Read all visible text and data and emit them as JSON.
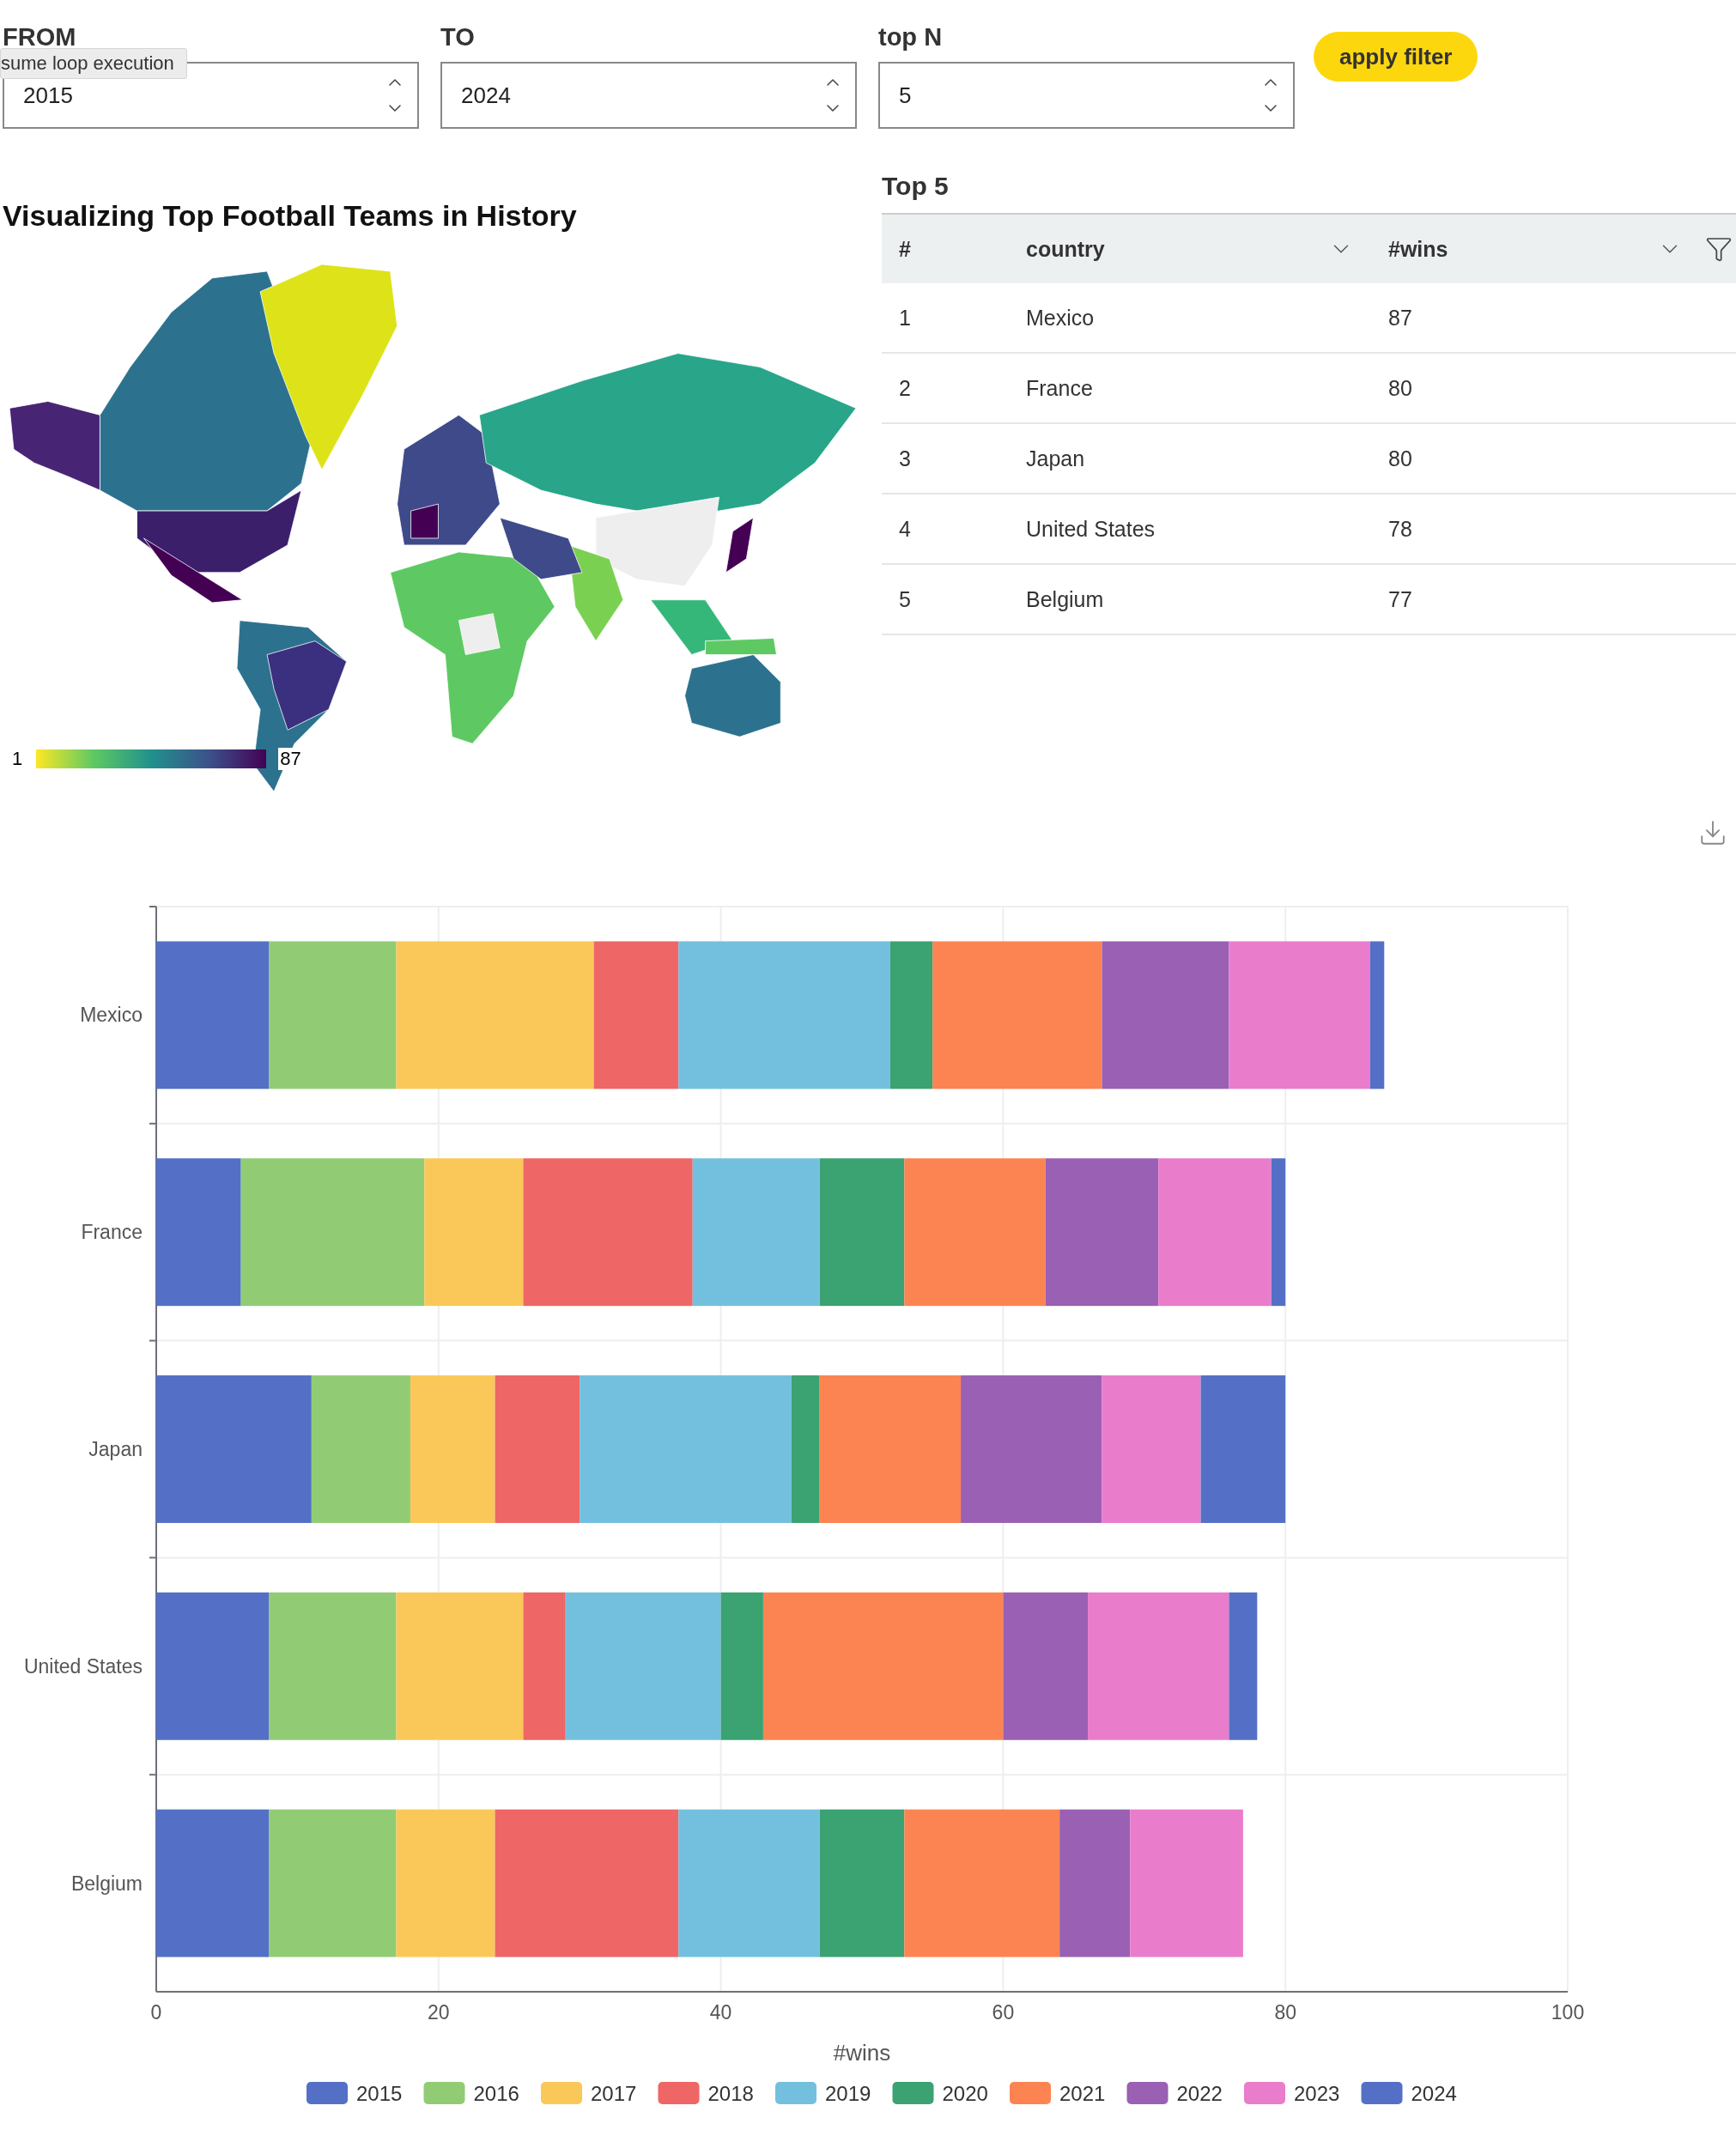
{
  "filters": [
    {
      "label": "FROM",
      "value": "2015"
    },
    {
      "label": "TO",
      "value": "2024"
    },
    {
      "label": "top N",
      "value": "5"
    }
  ],
  "tooltip": "sume loop execution",
  "apply_button": "apply filter",
  "map": {
    "title": "Visualizing Top Football Teams in History",
    "scale_min": "1",
    "scale_max": "87"
  },
  "table": {
    "title": "Top 5",
    "columns": [
      "#",
      "country",
      "#wins"
    ],
    "rows": [
      [
        "1",
        "Mexico",
        "87"
      ],
      [
        "2",
        "France",
        "80"
      ],
      [
        "3",
        "Japan",
        "80"
      ],
      [
        "4",
        "United States",
        "78"
      ],
      [
        "5",
        "Belgium",
        "77"
      ]
    ]
  },
  "chart": {
    "chart_data": {
      "type": "bar",
      "orientation": "horizontal",
      "stacked": true,
      "grid": true,
      "legend": true,
      "xlabel": "#wins",
      "xlim": [
        0,
        100
      ],
      "xticks": [
        {
          "value": 0,
          "label": "0"
        },
        {
          "value": 20,
          "label": "20"
        },
        {
          "value": 40,
          "label": "40"
        },
        {
          "value": 60,
          "label": "60"
        },
        {
          "value": 80,
          "label": "80"
        },
        {
          "value": 100,
          "label": "100"
        }
      ],
      "categories": [
        "Mexico",
        "France",
        "Japan",
        "United States",
        "Belgium"
      ],
      "series": [
        {
          "name": "2015",
          "color": "#5470c6",
          "values": [
            8,
            6,
            11,
            8,
            8
          ]
        },
        {
          "name": "2016",
          "color": "#91cc75",
          "values": [
            9,
            13,
            7,
            9,
            9
          ]
        },
        {
          "name": "2017",
          "color": "#fac858",
          "values": [
            14,
            7,
            6,
            9,
            7
          ]
        },
        {
          "name": "2018",
          "color": "#ee6666",
          "values": [
            6,
            12,
            6,
            3,
            13
          ]
        },
        {
          "name": "2019",
          "color": "#73c0de",
          "values": [
            15,
            9,
            15,
            11,
            10
          ]
        },
        {
          "name": "2020",
          "color": "#3ba272",
          "values": [
            3,
            6,
            2,
            3,
            6
          ]
        },
        {
          "name": "2021",
          "color": "#fc8452",
          "values": [
            12,
            10,
            10,
            17,
            11
          ]
        },
        {
          "name": "2022",
          "color": "#9a60b4",
          "values": [
            9,
            8,
            10,
            6,
            5
          ]
        },
        {
          "name": "2023",
          "color": "#ea7ccc",
          "values": [
            10,
            8,
            7,
            10,
            8
          ]
        },
        {
          "name": "2024",
          "color": "#5470c6",
          "values": [
            1,
            1,
            6,
            2,
            0
          ]
        }
      ]
    }
  }
}
